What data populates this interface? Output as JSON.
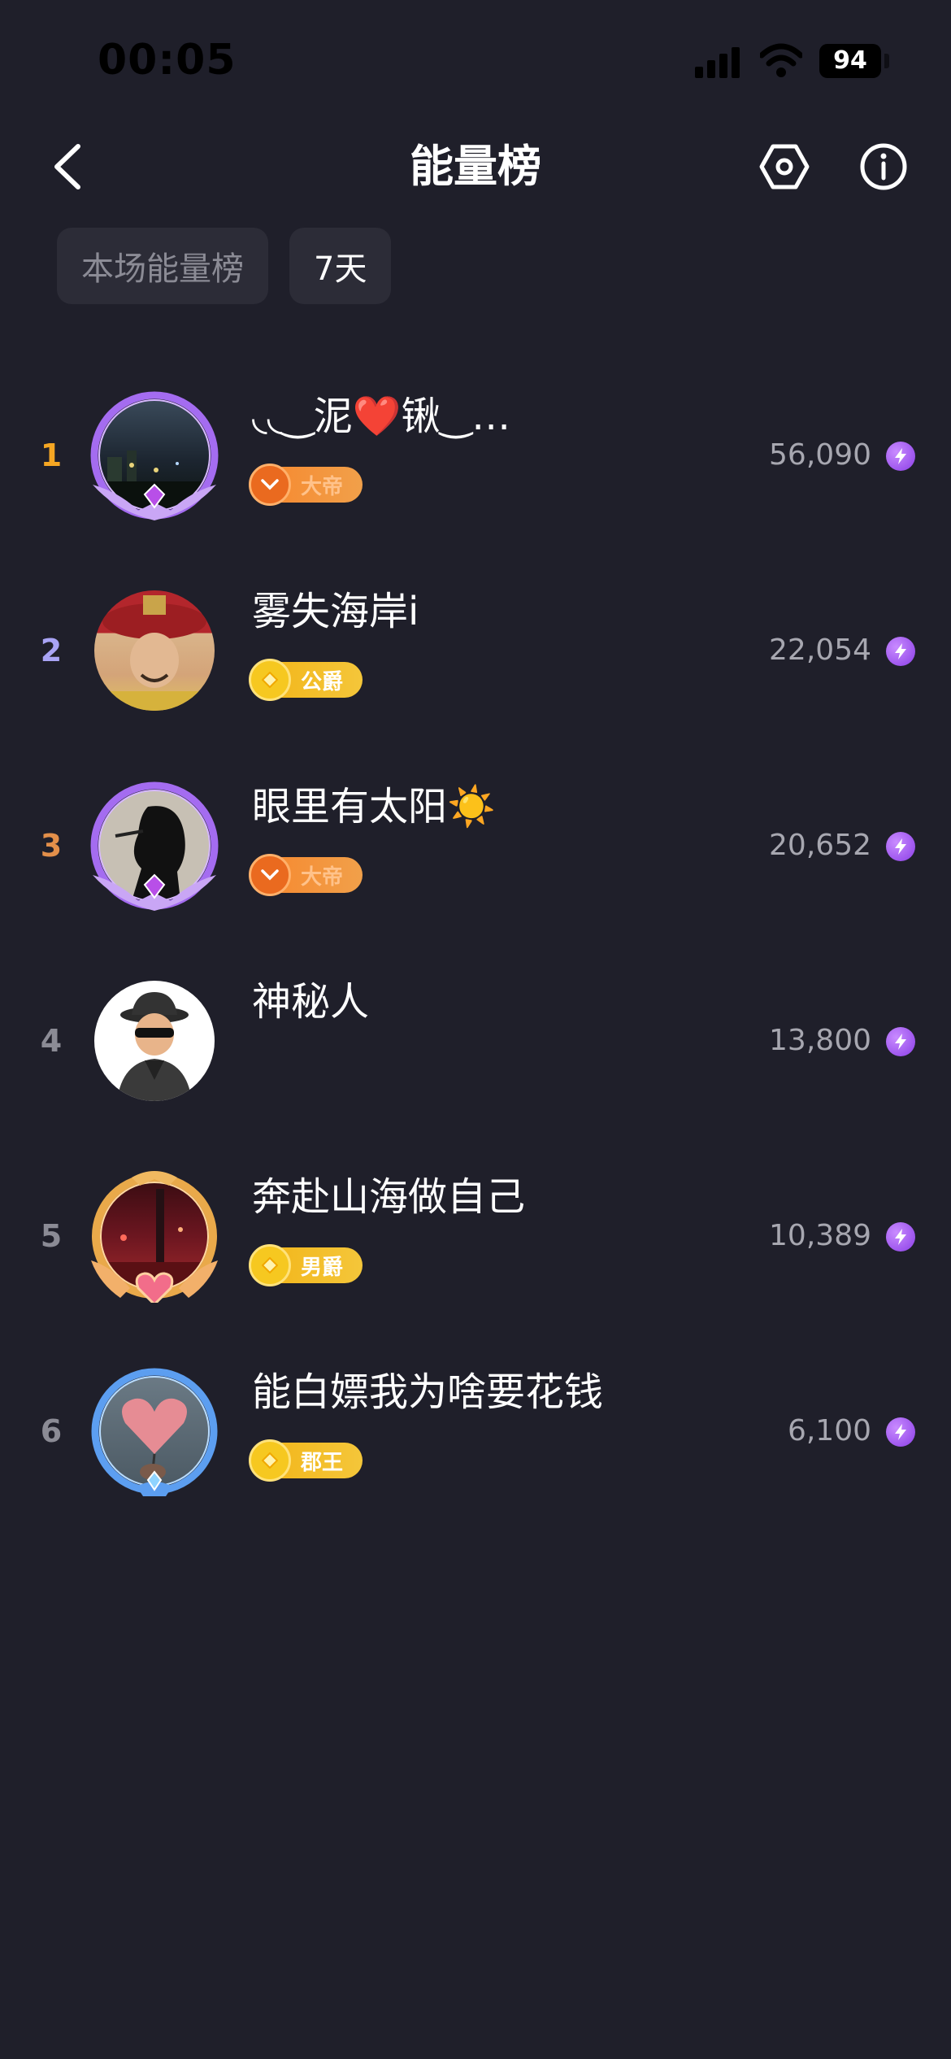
{
  "status_bar": {
    "time": "00:05",
    "battery": "94"
  },
  "header": {
    "title": "能量榜",
    "back_icon": "chevron-left-icon",
    "settings_icon": "hexagon-settings-icon",
    "info_icon": "info-circle-icon"
  },
  "tabs": [
    {
      "label": "本场能量榜",
      "active": false
    },
    {
      "label": "7天",
      "active": true
    }
  ],
  "colors": {
    "background": "#1f1f2a",
    "rank_1": "#f5a623",
    "rank_2": "#a9a4f5",
    "rank_3": "#e38f4a",
    "rank_other": "#8b8b95",
    "score": "#a7a7b0",
    "energy": "#9b4cf0"
  },
  "ranking": [
    {
      "rank": "1",
      "name": "◟◟‿泥❤️锹‿…",
      "badge": "大帝",
      "badge_style": "orange",
      "score": "56,090",
      "frame": "purple",
      "avatar": "city-night-photo"
    },
    {
      "rank": "2",
      "name": "雾失海岸i",
      "badge": "公爵",
      "badge_style": "gold",
      "score": "22,054",
      "frame": "none",
      "avatar": "official-in-red-hat-photo"
    },
    {
      "rank": "3",
      "name": "眼里有太阳☀️",
      "badge": "大帝",
      "badge_style": "orange",
      "score": "20,652",
      "frame": "purple",
      "avatar": "silhouette-smoking-photo"
    },
    {
      "rank": "4",
      "name": "神秘人",
      "badge": "",
      "badge_style": "",
      "score": "13,800",
      "frame": "none",
      "avatar": "mystery-man-icon"
    },
    {
      "rank": "5",
      "name": "奔赴山海做自己",
      "badge": "男爵",
      "badge_style": "gold",
      "score": "10,389",
      "frame": "gold-heart",
      "avatar": "red-night-street-photo"
    },
    {
      "rank": "6",
      "name": "能白嫖我为啥要花钱",
      "badge": "郡王",
      "badge_style": "gold",
      "score": "6,100",
      "frame": "blue",
      "avatar": "heart-balloon-photo"
    }
  ]
}
